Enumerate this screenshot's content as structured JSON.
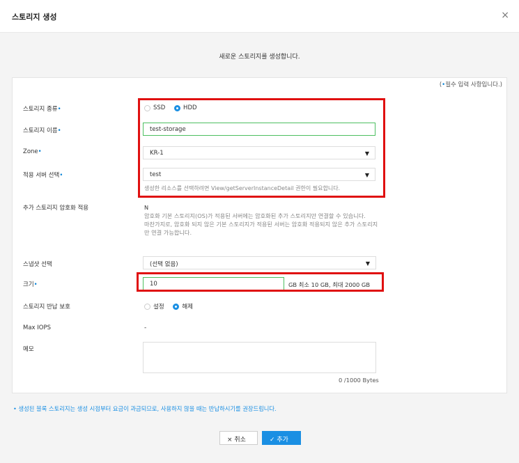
{
  "dialog": {
    "title": "스토리지 생성",
    "close_icon": "×",
    "subtitle": "새로운 스토리지를 생성합니다.",
    "required_note_pre": "(",
    "required_note_dot": "•",
    "required_note_text": "필수 입력 사항입니다.)"
  },
  "colors": {
    "accent": "#1a8fe3",
    "highlight_box": "#e01010",
    "valid_border": "#4cbf60"
  },
  "required_marker": "•",
  "form": {
    "storage_type": {
      "label": "스토리지 종류",
      "options": [
        "SSD",
        "HDD"
      ],
      "selected": "HDD"
    },
    "storage_name": {
      "label": "스토리지 이름",
      "value": "test-storage"
    },
    "zone": {
      "label": "Zone",
      "value": "KR-1"
    },
    "server": {
      "label": "적용 서버 선택",
      "value": "test",
      "helper": "생성한 리소스를 선택하려면 View/getServerInstanceDetail 권한이 필요합니다."
    },
    "encryption": {
      "label": "추가 스토리지 암호화 적용",
      "value": "N",
      "desc1": "암호화 기본 스토리지(OS)가 적용된 서버에는 암호화된 추가 스토리지만 연결할 수 있습니다.",
      "desc2": "마찬가지로, 암호화 되지 않은 기본 스토리지가 적용된 서버는 암호화 적용되지 않은 추가 스토리지만 연결 가능합니다."
    },
    "snapshot": {
      "label": "스냅샷 선택",
      "value": "(선택 없음)"
    },
    "size": {
      "label": "크기",
      "value": "10",
      "unit": "GB",
      "hint": "최소 10 GB, 최대 2000 GB"
    },
    "return_protection": {
      "label": "스토리지 반납 보호",
      "options": [
        "설정",
        "해제"
      ],
      "selected": "해제"
    },
    "max_iops": {
      "label": "Max IOPS",
      "value": "-"
    },
    "memo": {
      "label": "메모",
      "counter": "0 /1000 Bytes"
    }
  },
  "footnote": "• 생성된 블록 스토리지는 생성 시점부터 요금이 과금되므로, 사용하지 않을 때는 반납하시기를 권장드립니다.",
  "buttons": {
    "cancel": "× 취소",
    "add": "✓ 추가"
  }
}
